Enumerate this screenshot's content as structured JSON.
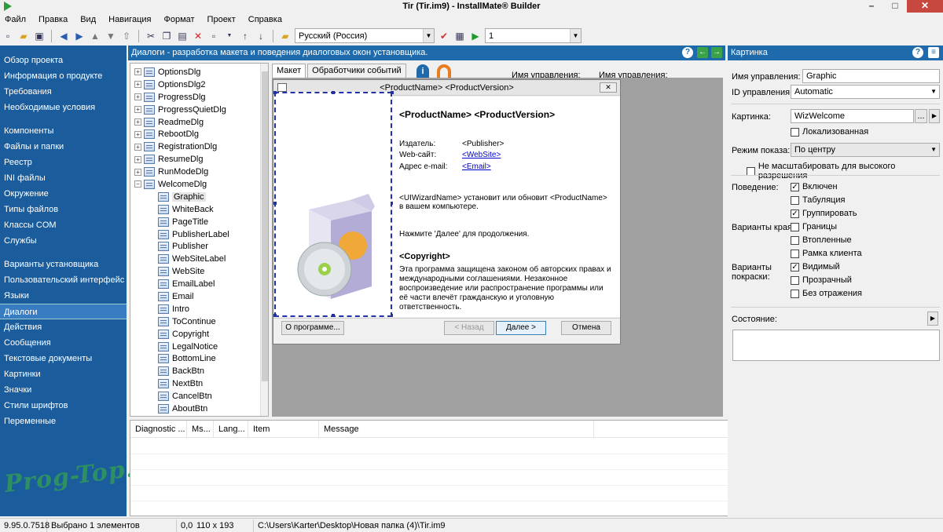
{
  "window": {
    "title": "Tir (Tir.im9) - InstallMate® Builder",
    "minimize": "–",
    "maximize": "□",
    "close": "✕"
  },
  "menu": [
    "Файл",
    "Правка",
    "Вид",
    "Навигация",
    "Формат",
    "Проект",
    "Справка"
  ],
  "toolbar": {
    "language": "Русский (Россия)",
    "number": "1"
  },
  "nav": {
    "groups": [
      [
        "Обзор проекта",
        "Информация о продукте",
        "Требования",
        "Необходимые условия"
      ],
      [
        "Компоненты",
        "Файлы и папки",
        "Реестр",
        "INI файлы",
        "Окружение",
        "Типы файлов",
        "Классы COM",
        "Службы"
      ],
      [
        "Варианты установщика",
        "Пользовательский интерфейс",
        "Языки",
        "Диалоги",
        "Действия",
        "Сообщения",
        "Текстовые документы",
        "Картинки",
        "Значки",
        "Стили шрифтов",
        "Переменные"
      ]
    ],
    "selected": "Диалоги"
  },
  "watermark": "Prog-Top.net",
  "center_header": "Диалоги - разработка макета и поведения диалоговых окон установщика.",
  "tree": {
    "collapsed": [
      "OptionsDlg",
      "OptionsDlg2",
      "ProgressDlg",
      "ProgressQuietDlg",
      "ReadmeDlg",
      "RebootDlg",
      "RegistrationDlg",
      "ResumeDlg",
      "RunModeDlg"
    ],
    "expanded": "WelcomeDlg",
    "children": [
      "Graphic",
      "WhiteBack",
      "PageTitle",
      "PublisherLabel",
      "Publisher",
      "WebSiteLabel",
      "WebSite",
      "EmailLabel",
      "Email",
      "Intro",
      "ToContinue",
      "Copyright",
      "LegalNotice",
      "BottomLine",
      "BackBtn",
      "NextBtn",
      "CancelBtn",
      "AboutBtn"
    ]
  },
  "tabs": [
    "Макет",
    "Обработчики событий"
  ],
  "props_header": {
    "name": "Имя управления:",
    "name2": "Имя управления:"
  },
  "dialog": {
    "title": "<ProductName> <ProductVersion>",
    "heading": "<ProductName> <ProductVersion>",
    "publisher_label": "Издатель:",
    "publisher": "<Publisher>",
    "website_label": "Web-сайт:",
    "website": "<WebSite>",
    "email_label": "Адрес e-mail:",
    "email": "<Email>",
    "intro": "<UIWizardName> установит или обновит <ProductName> в вашем компьютере.",
    "continue": "Нажмите 'Далее' для продолжения.",
    "copyright_title": "<Copyright>",
    "legal": "Эта программа защищена законом об авторских правах и международными соглашениями. Незаконное воспроизведение или распространение программы или её части влечёт гражданскую и уголовную ответственность.",
    "about": "О программе...",
    "back": "< Назад",
    "next": "Далее >",
    "cancel": "Отмена"
  },
  "diagnostics": {
    "columns": [
      "Diagnostic ...",
      "Ms...",
      "Lang...",
      "Item",
      "Message"
    ]
  },
  "right": {
    "header": "Картинка",
    "name_label": "Имя управления:",
    "name_value": "Graphic",
    "id_label": "ID управления:",
    "id_value": "Automatic",
    "image_label": "Картинка:",
    "image_value": "WizWelcome",
    "browse": "...",
    "localized": "Локализованная",
    "display_label": "Режим показа:",
    "display_value": "По центру",
    "nohidpi": "Не масштабировать для высокого разрешения",
    "behavior_label": "Поведение:",
    "behavior": [
      {
        "label": "Включен",
        "checked": true
      },
      {
        "label": "Табуляция",
        "checked": false
      },
      {
        "label": "Группировать",
        "checked": true
      }
    ],
    "edges_label": "Варианты края:",
    "edges": [
      {
        "label": "Границы",
        "checked": false
      },
      {
        "label": "Втопленные",
        "checked": false
      },
      {
        "label": "Рамка клиента",
        "checked": false
      }
    ],
    "paint_label": "Варианты покраски:",
    "paint": [
      {
        "label": "Видимый",
        "checked": true
      },
      {
        "label": "Прозрачный",
        "checked": false
      },
      {
        "label": "Без отражения",
        "checked": false
      }
    ],
    "state_label": "Состояние:"
  },
  "status": {
    "version": "9.95.0.7518",
    "selection": "Выбрано 1 элементов",
    "pos": "0,0",
    "size": "110 x 193",
    "path": "C:\\Users\\Karter\\Desktop\\Новая папка (4)\\Tir.im9"
  }
}
